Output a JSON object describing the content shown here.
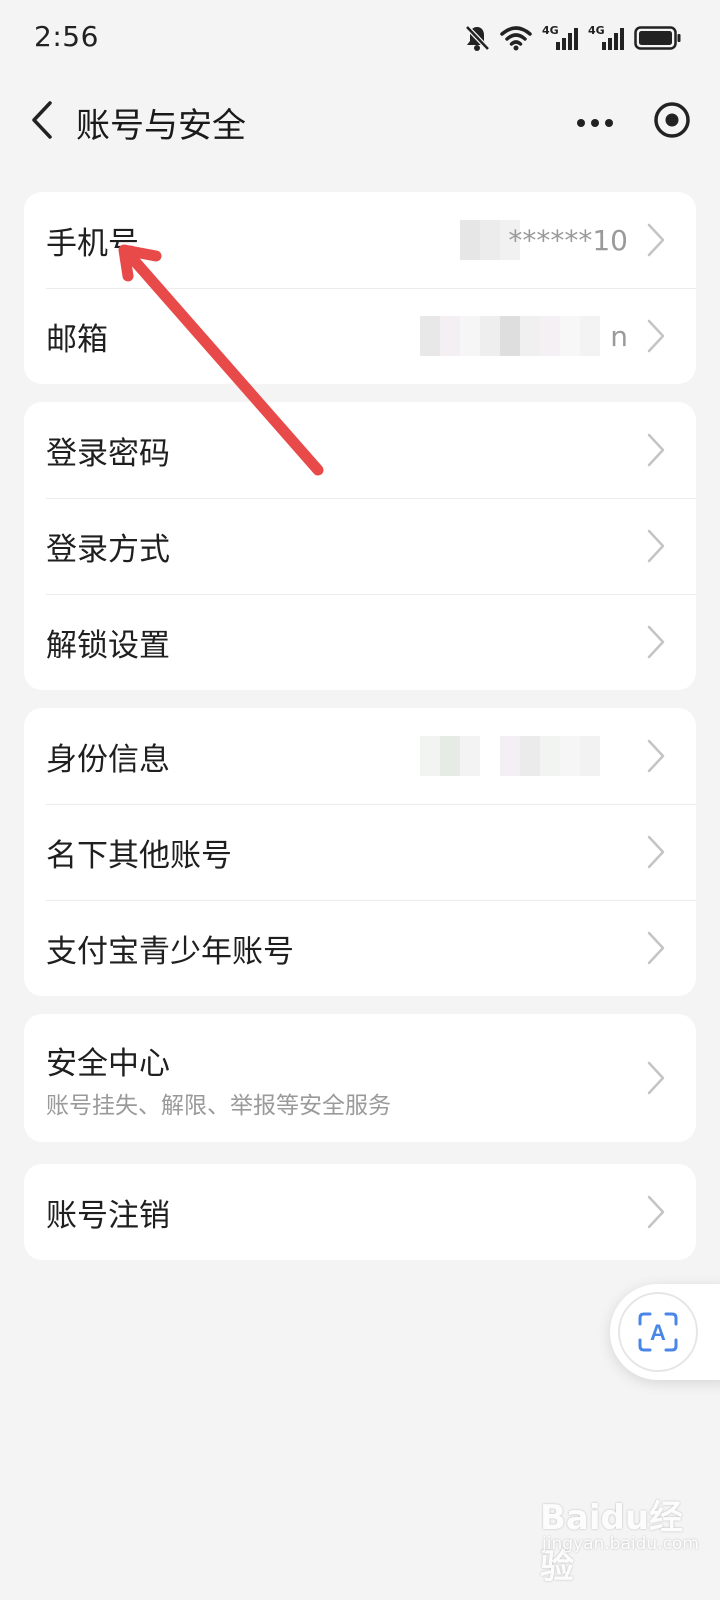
{
  "status_bar": {
    "time": "2:56",
    "icons": [
      "mute-bell-icon",
      "wifi-icon",
      "signal-4g-icon",
      "signal-4g-icon",
      "battery-icon"
    ],
    "network_labels": [
      "4G",
      "4G"
    ]
  },
  "nav": {
    "title": "账号与安全",
    "back_icon": "back-arrow-icon",
    "more_icon": "more-dots-icon",
    "target_icon": "target-circle-icon"
  },
  "groups": [
    {
      "rows": [
        {
          "label": "手机号",
          "value": "******10",
          "masked": true
        },
        {
          "label": "邮箱",
          "value": "n",
          "masked": true
        }
      ]
    },
    {
      "rows": [
        {
          "label": "登录密码"
        },
        {
          "label": "登录方式"
        },
        {
          "label": "解锁设置"
        }
      ]
    },
    {
      "rows": [
        {
          "label": "身份信息",
          "masked": true
        },
        {
          "label": "名下其他账号"
        },
        {
          "label": "支付宝青少年账号"
        }
      ]
    },
    {
      "rows": [
        {
          "label": "安全中心",
          "subtitle": "账号挂失、解限、举报等安全服务"
        }
      ]
    },
    {
      "rows": [
        {
          "label": "账号注销"
        }
      ]
    }
  ],
  "floating_button": {
    "icon": "scan-text-icon",
    "glyph": "A"
  },
  "annotation": {
    "type": "red-arrow",
    "color": "#e84a4a"
  },
  "colors": {
    "background": "#f4f4f4",
    "card": "#ffffff",
    "accent_blue": "#4a86e8",
    "annotation_red": "#e84a4a"
  },
  "watermark": {
    "brand": "Baidu经验",
    "url": "jingyan.baidu.com"
  }
}
